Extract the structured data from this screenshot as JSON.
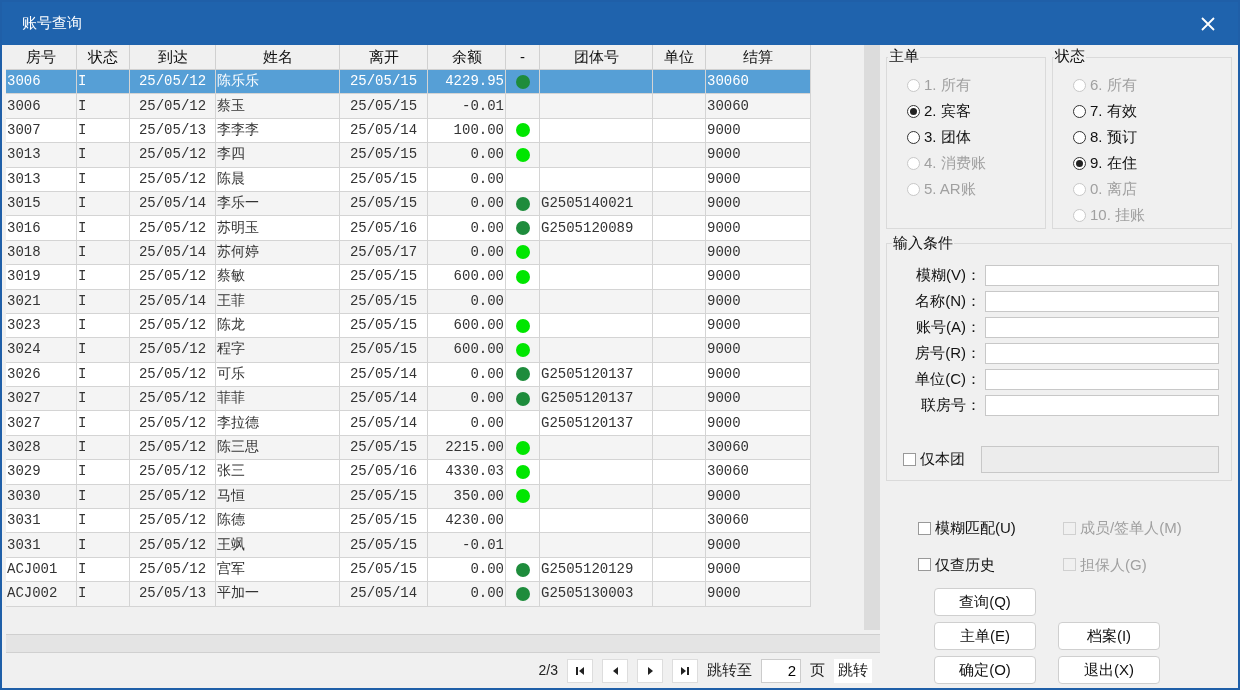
{
  "window": {
    "title": "账号查询"
  },
  "table": {
    "columns": [
      "房号",
      "状态",
      "到达",
      "姓名",
      "离开",
      "余额",
      "-",
      "团体号",
      "单位",
      "结算"
    ],
    "rows": [
      {
        "selected": true,
        "cells": [
          "3006",
          "I",
          "25/05/12",
          "陈乐乐",
          "25/05/15",
          "4229.95",
          "",
          "",
          "",
          "30060"
        ],
        "color": "#1e8c3c"
      },
      {
        "selected": false,
        "cells": [
          "3006",
          "I",
          "25/05/12",
          "蔡玉",
          "25/05/15",
          "-0.01",
          "",
          "",
          "",
          "30060"
        ]
      },
      {
        "selected": false,
        "cells": [
          "3007",
          "I",
          "25/05/13",
          "李李李",
          "25/05/14",
          "100.00",
          "",
          "",
          "",
          "9000"
        ],
        "color": "#00e600"
      },
      {
        "selected": false,
        "cells": [
          "3013",
          "I",
          "25/05/12",
          "李四",
          "25/05/15",
          "0.00",
          "",
          "",
          "",
          "9000"
        ],
        "color": "#00e600"
      },
      {
        "selected": false,
        "cells": [
          "3013",
          "I",
          "25/05/12",
          "陈晨",
          "25/05/15",
          "0.00",
          "",
          "",
          "",
          "9000"
        ]
      },
      {
        "selected": false,
        "cells": [
          "3015",
          "I",
          "25/05/14",
          "李乐一",
          "25/05/15",
          "0.00",
          "",
          "G2505140021",
          "",
          "9000"
        ],
        "color": "#1e8c3c"
      },
      {
        "selected": false,
        "cells": [
          "3016",
          "I",
          "25/05/12",
          "苏明玉",
          "25/05/16",
          "0.00",
          "",
          "G2505120089",
          "",
          "9000"
        ],
        "color": "#1e8c3c"
      },
      {
        "selected": false,
        "cells": [
          "3018",
          "I",
          "25/05/14",
          "苏何婷",
          "25/05/17",
          "0.00",
          "",
          "",
          "",
          "9000"
        ],
        "color": "#00e600"
      },
      {
        "selected": false,
        "cells": [
          "3019",
          "I",
          "25/05/12",
          "蔡敏",
          "25/05/15",
          "600.00",
          "",
          "",
          "",
          "9000"
        ],
        "color": "#00e600"
      },
      {
        "selected": false,
        "cells": [
          "3021",
          "I",
          "25/05/14",
          "王菲",
          "25/05/15",
          "0.00",
          "",
          "",
          "",
          "9000"
        ]
      },
      {
        "selected": false,
        "cells": [
          "3023",
          "I",
          "25/05/12",
          "陈龙",
          "25/05/15",
          "600.00",
          "",
          "",
          "",
          "9000"
        ],
        "color": "#00e600"
      },
      {
        "selected": false,
        "cells": [
          "3024",
          "I",
          "25/05/12",
          "程字",
          "25/05/15",
          "600.00",
          "",
          "",
          "",
          "9000"
        ],
        "color": "#00e600"
      },
      {
        "selected": false,
        "cells": [
          "3026",
          "I",
          "25/05/12",
          "可乐",
          "25/05/14",
          "0.00",
          "",
          "G2505120137",
          "",
          "9000"
        ],
        "color": "#1e8c3c"
      },
      {
        "selected": false,
        "cells": [
          "3027",
          "I",
          "25/05/12",
          "菲菲",
          "25/05/14",
          "0.00",
          "",
          "G2505120137",
          "",
          "9000"
        ],
        "color": "#1e8c3c"
      },
      {
        "selected": false,
        "cells": [
          "3027",
          "I",
          "25/05/12",
          "李拉德",
          "25/05/14",
          "0.00",
          "",
          "G2505120137",
          "",
          "9000"
        ]
      },
      {
        "selected": false,
        "cells": [
          "3028",
          "I",
          "25/05/12",
          "陈三思",
          "25/05/15",
          "2215.00",
          "",
          "",
          "",
          "30060"
        ],
        "color": "#00e600"
      },
      {
        "selected": false,
        "cells": [
          "3029",
          "I",
          "25/05/12",
          "张三",
          "25/05/16",
          "4330.03",
          "",
          "",
          "",
          "30060"
        ],
        "color": "#00e600"
      },
      {
        "selected": false,
        "cells": [
          "3030",
          "I",
          "25/05/12",
          "马恒",
          "25/05/15",
          "350.00",
          "",
          "",
          "",
          "9000"
        ],
        "color": "#00e600"
      },
      {
        "selected": false,
        "cells": [
          "3031",
          "I",
          "25/05/12",
          "陈德",
          "25/05/15",
          "4230.00",
          "",
          "",
          "",
          "30060"
        ]
      },
      {
        "selected": false,
        "cells": [
          "3031",
          "I",
          "25/05/12",
          "王飒",
          "25/05/15",
          "-0.01",
          "",
          "",
          "",
          "9000"
        ]
      },
      {
        "selected": false,
        "cells": [
          "ACJ001",
          "I",
          "25/05/12",
          "宫军",
          "25/05/15",
          "0.00",
          "",
          "G2505120129",
          "",
          "9000"
        ],
        "color": "#1e8c3c"
      },
      {
        "selected": false,
        "cells": [
          "ACJ002",
          "I",
          "25/05/13",
          "平加一",
          "25/05/14",
          "0.00",
          "",
          "G2505130003",
          "",
          "9000"
        ],
        "color": "#1e8c3c"
      }
    ]
  },
  "pagination": {
    "page_count": "2/3",
    "jump_label": "跳转至",
    "page_value": "2",
    "page_unit": "页",
    "jump_button": "跳转"
  },
  "main_order": {
    "title": "主单",
    "options": [
      {
        "label": "1. 所有",
        "selected": false,
        "disabled": true
      },
      {
        "label": "2. 宾客",
        "selected": true,
        "disabled": false
      },
      {
        "label": "3. 团体",
        "selected": false,
        "disabled": false
      },
      {
        "label": "4. 消费账",
        "selected": false,
        "disabled": true
      },
      {
        "label": "5. AR账",
        "selected": false,
        "disabled": true
      }
    ]
  },
  "status": {
    "title": "状态",
    "options": [
      {
        "label": "6. 所有",
        "selected": false,
        "disabled": true
      },
      {
        "label": "7. 有效",
        "selected": false,
        "disabled": false
      },
      {
        "label": "8. 预订",
        "selected": false,
        "disabled": false
      },
      {
        "label": "9. 在住",
        "selected": true,
        "disabled": false
      },
      {
        "label": "0. 离店",
        "selected": false,
        "disabled": true
      },
      {
        "label": "10. 挂账",
        "selected": false,
        "disabled": true
      }
    ]
  },
  "conditions": {
    "title": "输入条件",
    "fields": [
      {
        "label": "模糊(V)："
      },
      {
        "label": "名称(N)："
      },
      {
        "label": "账号(A)："
      },
      {
        "label": "房号(R)："
      },
      {
        "label": "单位(C)："
      },
      {
        "label": "联房号："
      }
    ],
    "group_only": {
      "label": "仅本团",
      "checked": false,
      "disabled": false
    }
  },
  "options": [
    {
      "label": "模糊匹配(U)",
      "checked": false,
      "disabled": false
    },
    {
      "label": "成员/签单人(M)",
      "checked": false,
      "disabled": true
    },
    {
      "label": "仅查历史",
      "checked": false,
      "disabled": false
    },
    {
      "label": "担保人(G)",
      "checked": false,
      "disabled": true
    }
  ],
  "buttons": [
    [
      "查询(Q)"
    ],
    [
      "主单(E)",
      "档案(I)"
    ],
    [
      "确定(O)",
      "退出(X)"
    ]
  ]
}
